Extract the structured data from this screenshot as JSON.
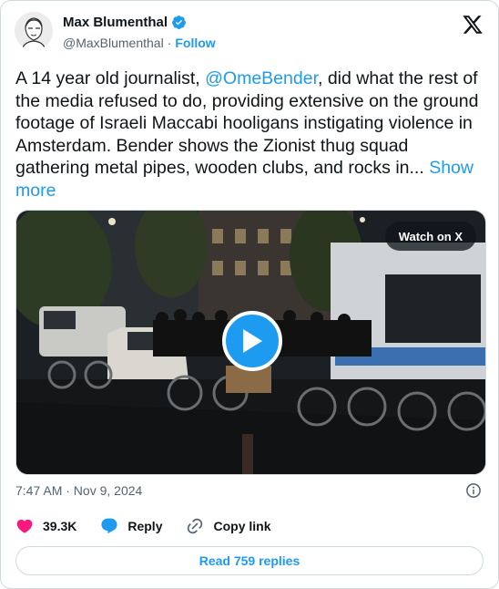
{
  "author": {
    "display_name": "Max Blumenthal",
    "handle": "@MaxBlumenthal",
    "separator": "·",
    "follow_label": "Follow"
  },
  "tweet": {
    "text_before": "A 14 year old journalist, ",
    "mention": "@OmeBender",
    "text_after": ", did what the rest of the media refused to do, providing extensive on the ground footage of Israeli Maccabi hooligans instigating violence in Amsterdam. Bender shows the Zionist thug squad gathering metal pipes, wooden clubs, and rocks in... ",
    "show_more": "Show more"
  },
  "media": {
    "watch_label": "Watch on X"
  },
  "timestamp": "7:47 AM · Nov 9, 2024",
  "actions": {
    "likes": "39.3K",
    "reply_label": "Reply",
    "copy_link_label": "Copy link"
  },
  "read_replies_label": "Read 759 replies",
  "colors": {
    "accent": "#1d9bf0",
    "like": "#f91880",
    "muted": "#536471"
  }
}
